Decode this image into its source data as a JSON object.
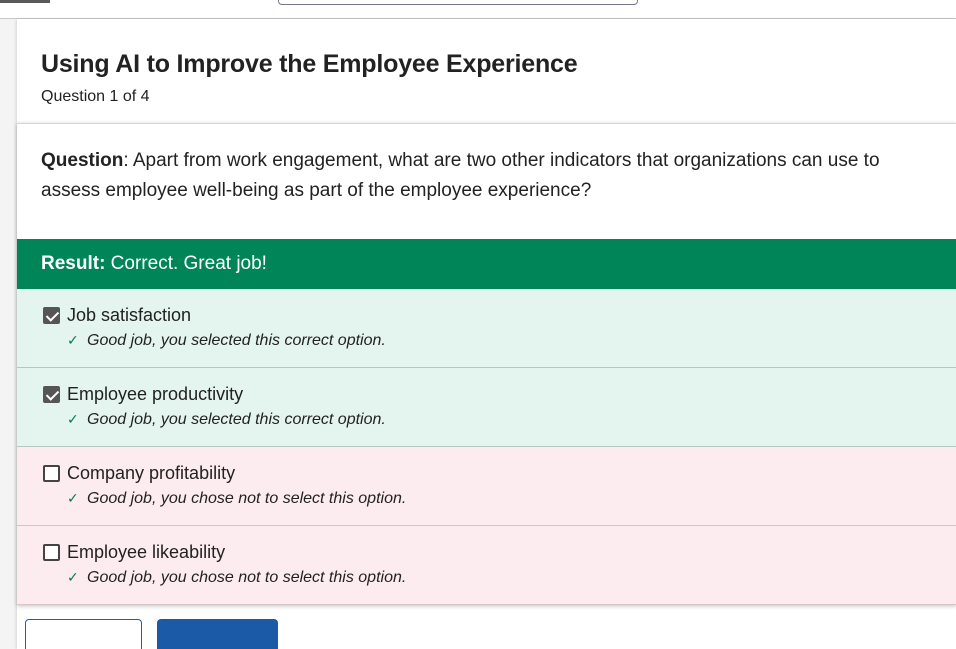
{
  "quiz": {
    "title": "Using AI to Improve the Employee Experience",
    "progress": "Question 1 of 4"
  },
  "question": {
    "prefix": "Question",
    "text": ": Apart from work engagement, what are two other indicators that organizations can use to assess employee well-being as part of the employee experience?"
  },
  "result": {
    "prefix": "Result:",
    "text": " Correct. Great job!"
  },
  "options": [
    {
      "label": "Job satisfaction",
      "checked": true,
      "feedback": "Good job, you selected this correct option."
    },
    {
      "label": "Employee productivity",
      "checked": true,
      "feedback": "Good job, you selected this correct option."
    },
    {
      "label": "Company profitability",
      "checked": false,
      "feedback": "Good job, you chose not to select this option."
    },
    {
      "label": "Employee likeability",
      "checked": false,
      "feedback": "Good job, you chose not to select this option."
    }
  ],
  "colors": {
    "result_bg": "#008558",
    "correct_row_bg": "#e4f4ee",
    "unselected_row_bg": "#fdecef",
    "button_primary": "#1a5aa6"
  },
  "icons": {
    "feedback": "check-icon",
    "checked": "checkbox-checked-icon",
    "unchecked": "checkbox-unchecked-icon"
  }
}
